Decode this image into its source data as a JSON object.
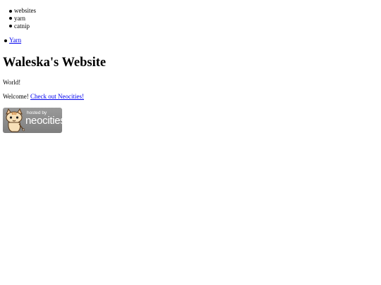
{
  "tags": [
    "websites",
    "yarn",
    "catnip"
  ],
  "nav": {
    "items": [
      {
        "label": "Yarn"
      }
    ]
  },
  "header": {
    "title": "Waleska's Website"
  },
  "content": {
    "greeting": "World!",
    "welcome_text": "Welcome!",
    "welcome_link": "Check out Neocities!"
  },
  "badge": {
    "hosted_by": "hosted by",
    "brand": "neocities",
    "icon": "neocities-cat-icon"
  },
  "colors": {
    "link": "#0000ee",
    "badge_background": "#8f8f8f",
    "text": "#000000"
  }
}
